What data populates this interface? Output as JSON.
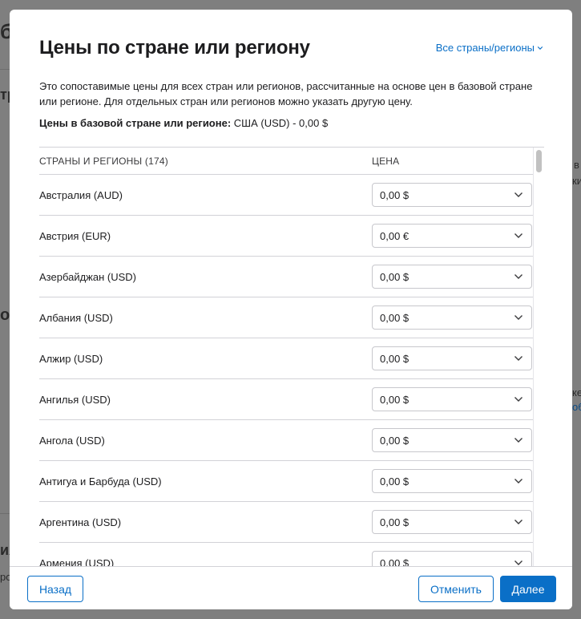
{
  "background": {
    "fragments": [
      "бр",
      "тр",
      "ос",
      "ия",
      "ро",
      "в",
      "ки",
      "ке",
      "об"
    ]
  },
  "modal": {
    "title": "Цены по стране или региону",
    "filter_label": "Все страны/регионы",
    "description": "Это сопоставимые цены для всех стран или регионов, рассчитанные на основе цен в базовой стране или регионе. Для отдельных стран или регионов можно указать другую цену.",
    "base_label": "Цены в базовой стране или регионе:",
    "base_value": "США (USD) - 0,00 $",
    "table": {
      "header_country": "СТРАНЫ И РЕГИОНЫ (174)",
      "header_price": "ЦЕНА",
      "rows": [
        {
          "country": "Австралия (AUD)",
          "price": "0,00 $"
        },
        {
          "country": "Австрия (EUR)",
          "price": "0,00 €"
        },
        {
          "country": "Азербайджан (USD)",
          "price": "0,00 $"
        },
        {
          "country": "Албания (USD)",
          "price": "0,00 $"
        },
        {
          "country": "Алжир (USD)",
          "price": "0,00 $"
        },
        {
          "country": "Ангилья (USD)",
          "price": "0,00 $"
        },
        {
          "country": "Ангола (USD)",
          "price": "0,00 $"
        },
        {
          "country": "Антигуа и Барбуда (USD)",
          "price": "0,00 $"
        },
        {
          "country": "Аргентина (USD)",
          "price": "0,00 $"
        },
        {
          "country": "Армения (USD)",
          "price": "0,00 $"
        }
      ]
    },
    "footer": {
      "back_label": "Назад",
      "cancel_label": "Отменить",
      "next_label": "Далее"
    }
  },
  "colors": {
    "accent": "#0a6fc7",
    "overlay": "#7f7f7f",
    "border": "#d2d2d7"
  }
}
